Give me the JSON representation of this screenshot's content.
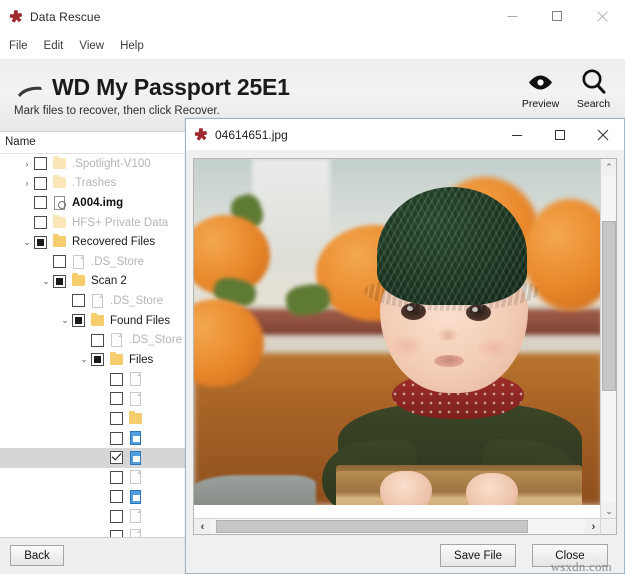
{
  "window": {
    "title": "Data Rescue",
    "logo_icon": "red-cross-logo-icon",
    "minimize_label": "─",
    "maximize_label": "□",
    "close_label": "✕"
  },
  "menubar": {
    "items": [
      {
        "label": "File"
      },
      {
        "label": "Edit"
      },
      {
        "label": "View"
      },
      {
        "label": "Help"
      }
    ]
  },
  "header": {
    "drive_icon": "external-drive-icon",
    "drive_title": "WD My Passport 25E1",
    "instruction": "Mark files to recover, then click Recover.",
    "tools": [
      {
        "label": "Preview",
        "icon": "eye-icon"
      },
      {
        "label": "Search",
        "icon": "magnifier-icon"
      }
    ]
  },
  "tree": {
    "column_header": "Name",
    "rows": [
      {
        "indent": 1,
        "twisty": "›",
        "check": "empty",
        "icon": "folder-pale-icon",
        "label": ".Spotlight-V100",
        "dim": true
      },
      {
        "indent": 1,
        "twisty": "›",
        "check": "empty",
        "icon": "folder-pale-icon",
        "label": ".Trashes",
        "dim": true
      },
      {
        "indent": 1,
        "twisty": "",
        "check": "empty",
        "icon": "disc-image-icon",
        "label": "A004.img",
        "dim": false,
        "bold": true
      },
      {
        "indent": 1,
        "twisty": "",
        "check": "empty",
        "icon": "folder-pale-icon",
        "label": "HFS+ Private Data",
        "dim": true
      },
      {
        "indent": 1,
        "twisty": "⌄",
        "check": "partial",
        "icon": "folder-icon",
        "label": "Recovered Files",
        "dim": false
      },
      {
        "indent": 2,
        "twisty": "",
        "check": "empty",
        "icon": "document-icon",
        "label": ".DS_Store",
        "dim": true
      },
      {
        "indent": 2,
        "twisty": "⌄",
        "check": "partial",
        "icon": "folder-icon",
        "label": "Scan 2",
        "dim": false
      },
      {
        "indent": 3,
        "twisty": "",
        "check": "empty",
        "icon": "document-icon",
        "label": ".DS_Store",
        "dim": true
      },
      {
        "indent": 3,
        "twisty": "⌄",
        "check": "partial",
        "icon": "folder-icon",
        "label": "Found Files",
        "dim": false
      },
      {
        "indent": 4,
        "twisty": "",
        "check": "empty",
        "icon": "document-icon",
        "label": ".DS_Store",
        "dim": true
      },
      {
        "indent": 4,
        "twisty": "⌄",
        "check": "partial",
        "icon": "folder-icon",
        "label": "Files",
        "dim": false
      },
      {
        "indent": 5,
        "twisty": "",
        "check": "empty",
        "icon": "document-icon",
        "label": "",
        "dim": true
      },
      {
        "indent": 5,
        "twisty": "",
        "check": "empty",
        "icon": "document-icon",
        "label": "",
        "dim": true
      },
      {
        "indent": 5,
        "twisty": "",
        "check": "empty",
        "icon": "folder-icon",
        "label": "",
        "dim": true
      },
      {
        "indent": 5,
        "twisty": "",
        "check": "empty",
        "icon": "image-file-icon",
        "label": "",
        "dim": true
      },
      {
        "indent": 5,
        "twisty": "",
        "check": "checked",
        "icon": "image-file-icon",
        "label": "",
        "dim": false,
        "selected": true
      },
      {
        "indent": 5,
        "twisty": "",
        "check": "empty",
        "icon": "document-icon",
        "label": "",
        "dim": true
      },
      {
        "indent": 5,
        "twisty": "",
        "check": "empty",
        "icon": "image-file-icon",
        "label": "",
        "dim": true
      },
      {
        "indent": 5,
        "twisty": "",
        "check": "empty",
        "icon": "document-icon",
        "label": "",
        "dim": true
      },
      {
        "indent": 5,
        "twisty": "",
        "check": "empty",
        "icon": "document-icon",
        "label": "",
        "dim": true
      },
      {
        "indent": 5,
        "twisty": "",
        "check": "empty",
        "icon": "archive-icon",
        "label": "",
        "dim": true
      }
    ]
  },
  "footer": {
    "back_label": "Back"
  },
  "dialog": {
    "logo_icon": "red-cross-logo-icon",
    "title": "04614651.jpg",
    "minimize_label": "─",
    "maximize_label": "□",
    "close_label": "✕",
    "scroll_up": "⌃",
    "scroll_down": "⌄",
    "scroll_left": "‹",
    "scroll_right": "›",
    "save_label": "Save File",
    "close_label_btn": "Close"
  },
  "watermark": {
    "text": "wsxdn.com"
  },
  "colors": {
    "accent_red": "#9e2a2f",
    "header_band": "#efefef",
    "selection": "#d6d6d6",
    "folder": "#f5cd6d",
    "image_icon": "#4f9fe0"
  }
}
